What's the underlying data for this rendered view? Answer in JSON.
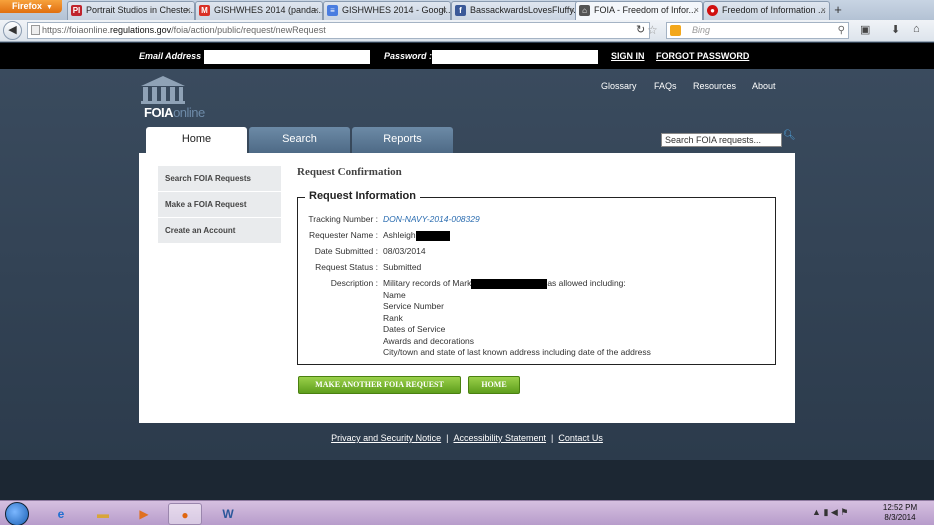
{
  "browser": {
    "app_button": "Firefox",
    "tabs": [
      {
        "icon": "PI",
        "icon_color": "#c0242c",
        "title": "Portrait Studios in Cheste..."
      },
      {
        "icon": "M",
        "icon_color": "#d93025",
        "title": "GISHWHES 2014 (panda..."
      },
      {
        "icon": "≡",
        "icon_color": "#4a7de0",
        "title": "GISHWHES 2014 - Googl..."
      },
      {
        "icon": "f",
        "icon_color": "#3b5998",
        "title": "BassackwardsLovesFluffy..."
      },
      {
        "icon": "⌂",
        "icon_color": "#555555",
        "title": "FOIA - Freedom of Infor..."
      },
      {
        "icon": "●",
        "icon_color": "#d01010",
        "title": "Freedom of Information ..."
      }
    ],
    "url_prefix": "https://foiaonline.",
    "url_domain": "regulations.gov",
    "url_path": "/foia/action/public/request/newRequest",
    "search_placeholder": "Bing"
  },
  "login": {
    "email_label": "Email Address :",
    "password_label": "Password :",
    "sign_in": "SIGN IN",
    "forgot_password": "FORGOT PASSWORD"
  },
  "site": {
    "logo_a": "FOIA",
    "logo_b": "online",
    "top_nav": [
      "Glossary",
      "FAQs",
      "Resources",
      "About"
    ],
    "tabs": [
      "Home",
      "Search",
      "Reports"
    ],
    "search_placeholder": "Search FOIA requests..."
  },
  "sidebar": [
    "Search FOIA Requests",
    "Make a FOIA Request",
    "Create an Account"
  ],
  "page": {
    "title": "Request Confirmation",
    "legend": "Request Information",
    "fields": {
      "tracking_label": "Tracking Number :",
      "tracking_value": "DON-NAVY-2014-008329",
      "requester_label": "Requester Name :",
      "requester_value": "Ashleigh",
      "submitted_label": "Date Submitted :",
      "submitted_value": "08/03/2014",
      "status_label": "Request Status :",
      "status_value": "Submitted",
      "description_label": "Description :",
      "description_start": "Military records of Mark",
      "description_end": "as allowed including:",
      "description_items": [
        "Name",
        "Service Number",
        "Rank",
        "Dates of Service",
        "Awards and decorations",
        "City/town and state of last known address including date of the address"
      ]
    },
    "buttons": {
      "another": "MAKE ANOTHER FOIA REQUEST",
      "home": "HOME"
    }
  },
  "footer": {
    "links": [
      "Privacy and Security Notice",
      "Accessibility Statement",
      "Contact Us"
    ],
    "separator": "|"
  },
  "taskbar": {
    "time": "12:52 PM",
    "date": "8/3/2014"
  }
}
